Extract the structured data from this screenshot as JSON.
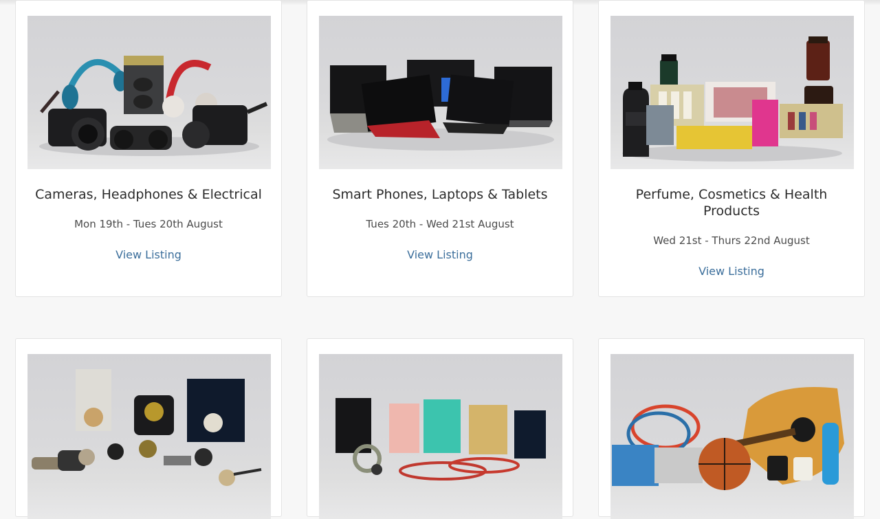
{
  "colors": {
    "background": "#f7f7f7",
    "card": "#ffffff",
    "link": "#3b6e9b",
    "title": "#2b2b2b",
    "dates": "#4a4a4a"
  },
  "listings": [
    {
      "title": "Cameras, Headphones & Electrical",
      "dates": "Mon 19th - Tues 20th August",
      "link_label": "View Listing",
      "image": "cameras-headphones-photo"
    },
    {
      "title": "Smart Phones, Laptops & Tablets",
      "dates": "Tues 20th - Wed 21st August",
      "link_label": "View Listing",
      "image": "laptops-tablets-photo"
    },
    {
      "title": "Perfume, Cosmetics & Health Products",
      "dates": "Wed 21st - Thurs 22nd August",
      "link_label": "View Listing",
      "image": "cosmetics-health-photo"
    },
    {
      "image": "watches-photo"
    },
    {
      "image": "jewellery-photo"
    },
    {
      "image": "toys-sports-music-photo"
    }
  ]
}
